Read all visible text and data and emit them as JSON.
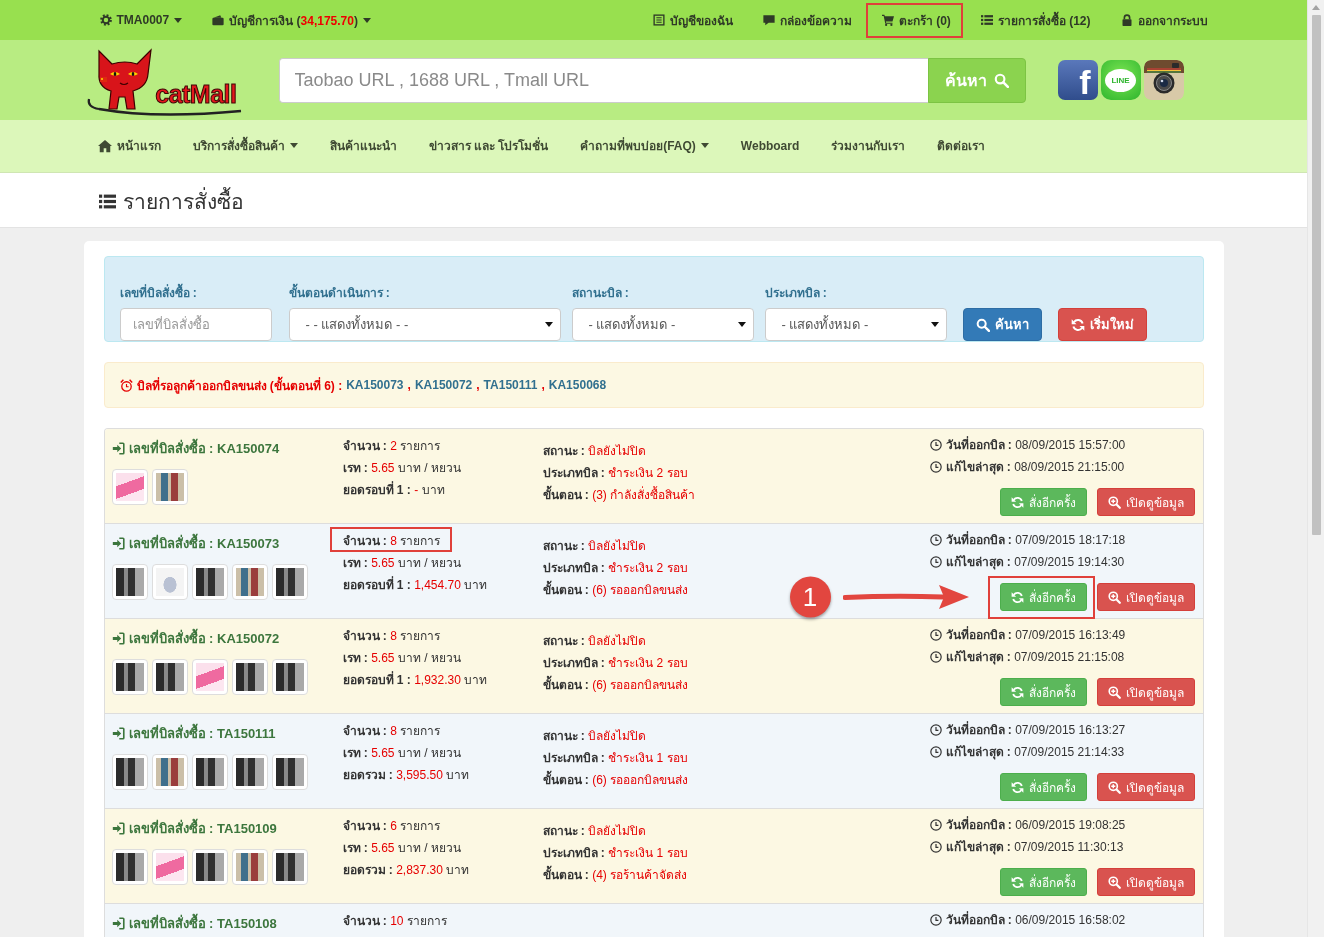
{
  "top_bar": {
    "left": [
      {
        "kind": "account",
        "label": "TMA0007",
        "dropdown": true
      },
      {
        "kind": "wallet",
        "label": "บัญชีการเงิน (",
        "value": "34,175.70",
        "suffix": ")",
        "dropdown": true
      }
    ],
    "right": [
      {
        "kind": "profile",
        "label": "บัญชีของฉัน",
        "highlighted": false
      },
      {
        "kind": "messages",
        "label": "กล่องข้อความ",
        "highlighted": false
      },
      {
        "kind": "cart",
        "label": "ตะกร้า (0)",
        "highlighted": true
      },
      {
        "kind": "orders",
        "label": "รายการสั่งซื้อ (12)",
        "highlighted": false
      },
      {
        "kind": "logout",
        "label": "ออกจากระบบ",
        "highlighted": false
      }
    ]
  },
  "header": {
    "logo_text": "catMall",
    "search": {
      "placeholder": "Taobao URL , 1688 URL , Tmall URL",
      "button": "ค้นหา"
    },
    "social": [
      {
        "kind": "facebook",
        "label": "f"
      },
      {
        "kind": "line",
        "label": "LINE"
      },
      {
        "kind": "instagram"
      }
    ]
  },
  "nav": [
    {
      "kind": "home",
      "label": "หน้าแรก",
      "dropdown": false
    },
    {
      "kind": "link",
      "label": "บริการสั่งซื้อสินค้า",
      "dropdown": true
    },
    {
      "kind": "link",
      "label": "สินค้าแนะนำ",
      "dropdown": false
    },
    {
      "kind": "link",
      "label": "ข่าวสาร และ โปรโมชั่น",
      "dropdown": false
    },
    {
      "kind": "link",
      "label": "คำถามที่พบบ่อย(FAQ)",
      "dropdown": true
    },
    {
      "kind": "link",
      "label": "Webboard",
      "dropdown": false
    },
    {
      "kind": "link",
      "label": "ร่วมงานกับเรา",
      "dropdown": false
    },
    {
      "kind": "link",
      "label": "ติดต่อเรา",
      "dropdown": false
    }
  ],
  "page_title": "รายการสั่งซื้อ",
  "filters": {
    "fields": [
      {
        "kind": "text",
        "label": "เลขที่บิลสั่งซื้อ :",
        "placeholder": "เลขที่บิลสั่งซื้อ"
      },
      {
        "kind": "select",
        "label": "ขั้นตอนดำเนินการ :",
        "value": "- - แสดงทั้งหมด - -"
      },
      {
        "kind": "select",
        "label": "สถานะบิล :",
        "value": "- แสดงทั้งหมด -"
      },
      {
        "kind": "select",
        "label": "ประเภทบิล :",
        "value": "- แสดงทั้งหมด -"
      }
    ],
    "buttons": [
      {
        "kind": "search",
        "label": "ค้นหา"
      },
      {
        "kind": "reset",
        "label": "เริ่มใหม่"
      }
    ]
  },
  "notice": {
    "label": "บิลที่รอลูกค้าออกบิลขนส่ง (ขั้นตอนที่ 6) :",
    "links": [
      {
        "label": "KA150073",
        "separator": ","
      },
      {
        "label": "KA150072",
        "separator": ","
      },
      {
        "label": "TA150111",
        "separator": ","
      },
      {
        "label": "KA150068"
      }
    ]
  },
  "orders": [
    {
      "number_label": "เลขที่บิลสั่งซื้อ :",
      "number": "KA150074",
      "thumbnails": [
        {
          "kind": "pink"
        },
        {
          "kind": "people"
        }
      ],
      "details": [
        {
          "label": "จำนวน :",
          "value": "2",
          "unit": "รายการ",
          "highlighted": false
        },
        {
          "label": "เรท :",
          "value": "5.65",
          "unit": "บาท / หยวน",
          "highlighted": false
        },
        {
          "label": "ยอดรอบที่ 1 :",
          "value": "-",
          "unit": "บาท",
          "highlighted": false
        }
      ],
      "status": [
        {
          "label": "สถานะ :",
          "value": "บิลยังไม่ปิด"
        },
        {
          "label": "ประเภทบิล :",
          "value": "ชำระเงิน 2 รอบ"
        },
        {
          "label": "ขั้นตอน :",
          "value": "(3) กำลังสั่งซื้อสินค้า"
        }
      ],
      "dates": [
        {
          "label": "วันที่ออกบิล :",
          "value": "08/09/2015 15:57:00"
        },
        {
          "label": "แก้ไขล่าสุด :",
          "value": "08/09/2015 21:15:00"
        }
      ],
      "buttons": [
        {
          "kind": "reorder",
          "label": "สั่งอีกครั้ง",
          "highlighted": false
        },
        {
          "kind": "view",
          "label": "เปิดดูข้อมูล",
          "highlighted": false
        }
      ]
    },
    {
      "number_label": "เลขที่บิลสั่งซื้อ :",
      "number": "KA150073",
      "thumbnails": [
        {
          "kind": "dark"
        },
        {
          "kind": "sandal"
        },
        {
          "kind": "dark"
        },
        {
          "kind": "people"
        },
        {
          "kind": "dark"
        }
      ],
      "details": [
        {
          "label": "จำนวน :",
          "value": "8",
          "unit": "รายการ",
          "highlighted": true
        },
        {
          "label": "เรท :",
          "value": "5.65",
          "unit": "บาท / หยวน",
          "highlighted": false
        },
        {
          "label": "ยอดรอบที่ 1 :",
          "value": "1,454.70",
          "unit": "บาท",
          "highlighted": false
        }
      ],
      "status": [
        {
          "label": "สถานะ :",
          "value": "บิลยังไม่ปิด"
        },
        {
          "label": "ประเภทบิล :",
          "value": "ชำระเงิน 2 รอบ"
        },
        {
          "label": "ขั้นตอน :",
          "value": "(6) รอออกบิลขนส่ง"
        }
      ],
      "dates": [
        {
          "label": "วันที่ออกบิล :",
          "value": "07/09/2015 18:17:18"
        },
        {
          "label": "แก้ไขล่าสุด :",
          "value": "07/09/2015 19:14:30"
        }
      ],
      "buttons": [
        {
          "kind": "reorder",
          "label": "สั่งอีกครั้ง",
          "highlighted": true
        },
        {
          "kind": "view",
          "label": "เปิดดูข้อมูล",
          "highlighted": false
        }
      ],
      "callout": "1"
    },
    {
      "number_label": "เลขที่บิลสั่งซื้อ :",
      "number": "KA150072",
      "thumbnails": [
        {
          "kind": "dark"
        },
        {
          "kind": "dark"
        },
        {
          "kind": "pink"
        },
        {
          "kind": "dark"
        },
        {
          "kind": "dark"
        }
      ],
      "details": [
        {
          "label": "จำนวน :",
          "value": "8",
          "unit": "รายการ",
          "highlighted": false
        },
        {
          "label": "เรท :",
          "value": "5.65",
          "unit": "บาท / หยวน",
          "highlighted": false
        },
        {
          "label": "ยอดรอบที่ 1 :",
          "value": "1,932.30",
          "unit": "บาท",
          "highlighted": false
        }
      ],
      "status": [
        {
          "label": "สถานะ :",
          "value": "บิลยังไม่ปิด"
        },
        {
          "label": "ประเภทบิล :",
          "value": "ชำระเงิน 2 รอบ"
        },
        {
          "label": "ขั้นตอน :",
          "value": "(6) รอออกบิลขนส่ง"
        }
      ],
      "dates": [
        {
          "label": "วันที่ออกบิล :",
          "value": "07/09/2015 16:13:49"
        },
        {
          "label": "แก้ไขล่าสุด :",
          "value": "07/09/2015 21:15:08"
        }
      ],
      "buttons": [
        {
          "kind": "reorder",
          "label": "สั่งอีกครั้ง",
          "highlighted": false
        },
        {
          "kind": "view",
          "label": "เปิดดูข้อมูล",
          "highlighted": false
        }
      ]
    },
    {
      "number_label": "เลขที่บิลสั่งซื้อ :",
      "number": "TA150111",
      "thumbnails": [
        {
          "kind": "dark"
        },
        {
          "kind": "people"
        },
        {
          "kind": "dark"
        },
        {
          "kind": "dark"
        },
        {
          "kind": "dark"
        }
      ],
      "details": [
        {
          "label": "จำนวน :",
          "value": "8",
          "unit": "รายการ",
          "highlighted": false
        },
        {
          "label": "เรท :",
          "value": "5.65",
          "unit": "บาท / หยวน",
          "highlighted": false
        },
        {
          "label": "ยอดรวม :",
          "value": "3,595.50",
          "unit": "บาท",
          "highlighted": false
        }
      ],
      "status": [
        {
          "label": "สถานะ :",
          "value": "บิลยังไม่ปิด"
        },
        {
          "label": "ประเภทบิล :",
          "value": "ชำระเงิน 1 รอบ"
        },
        {
          "label": "ขั้นตอน :",
          "value": "(6) รอออกบิลขนส่ง"
        }
      ],
      "dates": [
        {
          "label": "วันที่ออกบิล :",
          "value": "07/09/2015 16:13:27"
        },
        {
          "label": "แก้ไขล่าสุด :",
          "value": "07/09/2015 21:14:33"
        }
      ],
      "buttons": [
        {
          "kind": "reorder",
          "label": "สั่งอีกครั้ง",
          "highlighted": false
        },
        {
          "kind": "view",
          "label": "เปิดดูข้อมูล",
          "highlighted": false
        }
      ]
    },
    {
      "number_label": "เลขที่บิลสั่งซื้อ :",
      "number": "TA150109",
      "thumbnails": [
        {
          "kind": "dark"
        },
        {
          "kind": "pink"
        },
        {
          "kind": "dark"
        },
        {
          "kind": "people"
        },
        {
          "kind": "dark"
        }
      ],
      "details": [
        {
          "label": "จำนวน :",
          "value": "6",
          "unit": "รายการ",
          "highlighted": false
        },
        {
          "label": "เรท :",
          "value": "5.65",
          "unit": "บาท / หยวน",
          "highlighted": false
        },
        {
          "label": "ยอดรวม :",
          "value": "2,837.30",
          "unit": "บาท",
          "highlighted": false
        }
      ],
      "status": [
        {
          "label": "สถานะ :",
          "value": "บิลยังไม่ปิด"
        },
        {
          "label": "ประเภทบิล :",
          "value": "ชำระเงิน 1 รอบ"
        },
        {
          "label": "ขั้นตอน :",
          "value": "(4) รอร้านค้าจัดส่ง"
        }
      ],
      "dates": [
        {
          "label": "วันที่ออกบิล :",
          "value": "06/09/2015 19:08:25"
        },
        {
          "label": "แก้ไขล่าสุด :",
          "value": "07/09/2015 11:30:13"
        }
      ],
      "buttons": [
        {
          "kind": "reorder",
          "label": "สั่งอีกครั้ง",
          "highlighted": false
        },
        {
          "kind": "view",
          "label": "เปิดดูข้อมูล",
          "highlighted": false
        }
      ]
    },
    {
      "number_label": "เลขที่บิลสั่งซื้อ :",
      "number": "TA150108",
      "details": [
        {
          "label": "จำนวน :",
          "value": "10",
          "unit": "รายการ",
          "highlighted": false
        }
      ],
      "dates": [
        {
          "label": "วันที่ออกบิล :",
          "value": "06/09/2015 16:58:02"
        }
      ]
    }
  ]
}
